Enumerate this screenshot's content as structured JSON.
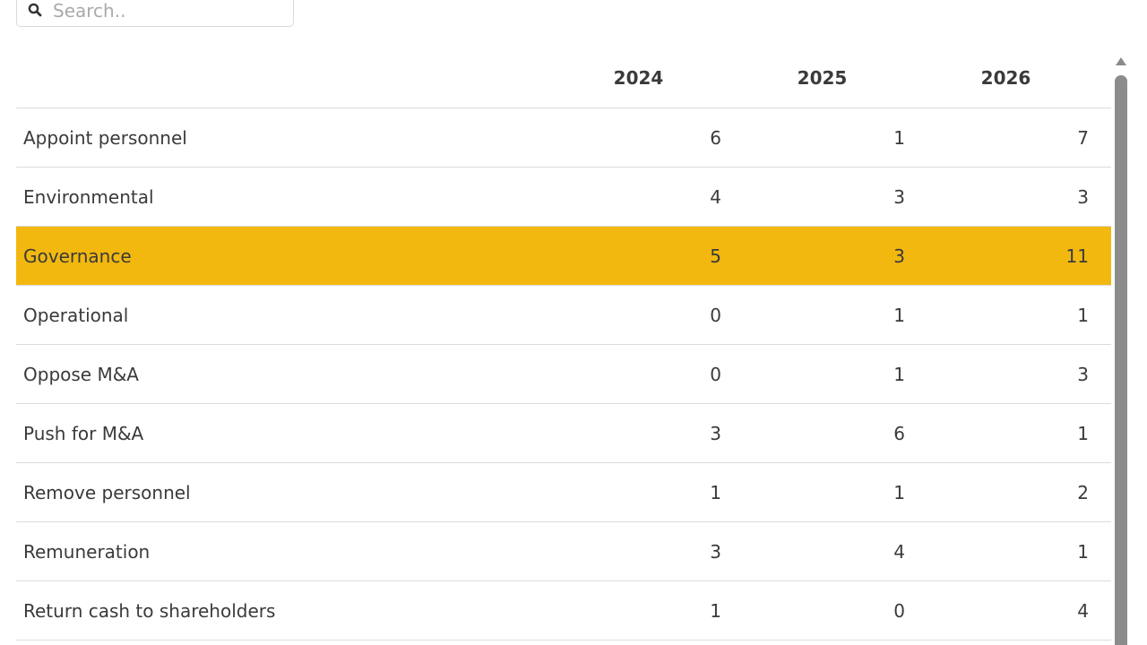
{
  "search": {
    "placeholder": "Search.."
  },
  "table": {
    "headers": [
      "",
      "2024",
      "2025",
      "2026"
    ],
    "rows": [
      {
        "label": "Appoint personnel",
        "values": [
          "6",
          "1",
          "7"
        ],
        "highlighted": false
      },
      {
        "label": "Environmental",
        "values": [
          "4",
          "3",
          "3"
        ],
        "highlighted": false
      },
      {
        "label": "Governance",
        "values": [
          "5",
          "3",
          "11"
        ],
        "highlighted": true
      },
      {
        "label": "Operational",
        "values": [
          "0",
          "1",
          "1"
        ],
        "highlighted": false
      },
      {
        "label": "Oppose M&A",
        "values": [
          "0",
          "1",
          "3"
        ],
        "highlighted": false
      },
      {
        "label": "Push for M&A",
        "values": [
          "3",
          "6",
          "1"
        ],
        "highlighted": false
      },
      {
        "label": "Remove personnel",
        "values": [
          "1",
          "1",
          "2"
        ],
        "highlighted": false
      },
      {
        "label": "Remuneration",
        "values": [
          "3",
          "4",
          "1"
        ],
        "highlighted": false
      },
      {
        "label": "Return cash to shareholders",
        "values": [
          "1",
          "0",
          "4"
        ],
        "highlighted": false
      }
    ]
  },
  "colors": {
    "highlight": "#f2b80f",
    "row_border": "#dcdcdc",
    "text": "#3a3a3a",
    "scrollbar_thumb": "#8c8c8c"
  },
  "icons": {
    "search": "search-icon",
    "scroll_up": "scroll-up-arrow-icon"
  }
}
